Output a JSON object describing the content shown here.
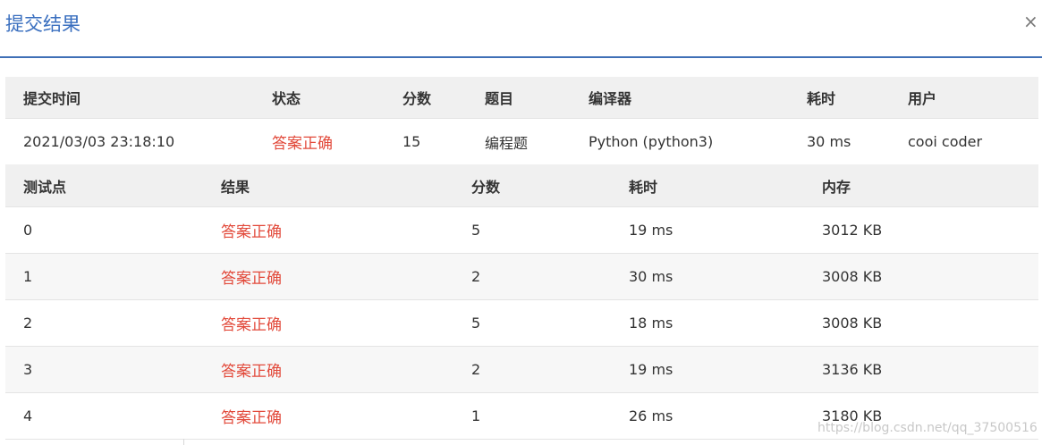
{
  "header": {
    "title": "提交结果",
    "close_label": "×"
  },
  "submission": {
    "columns": [
      "提交时间",
      "状态",
      "分数",
      "题目",
      "编译器",
      "耗时",
      "用户"
    ],
    "row": [
      "2021/03/03 23:18:10",
      "答案正确",
      "15",
      "编程题",
      "Python (python3)",
      "30 ms",
      "cooi coder"
    ]
  },
  "tests": {
    "columns": [
      "测试点",
      "结果",
      "分数",
      "耗时",
      "内存"
    ],
    "rows": [
      [
        "0",
        "答案正确",
        "5",
        "19 ms",
        "3012 KB"
      ],
      [
        "1",
        "答案正确",
        "2",
        "30 ms",
        "3008 KB"
      ],
      [
        "2",
        "答案正确",
        "5",
        "18 ms",
        "3008 KB"
      ],
      [
        "3",
        "答案正确",
        "2",
        "19 ms",
        "3136 KB"
      ],
      [
        "4",
        "答案正确",
        "1",
        "26 ms",
        "3180 KB"
      ]
    ]
  },
  "watermark": "https://blog.csdn.net/qq_37500516",
  "colors": {
    "title": "#3a6fbf",
    "accepted": "#e24a3b",
    "header_line": "#3f6fb6"
  }
}
